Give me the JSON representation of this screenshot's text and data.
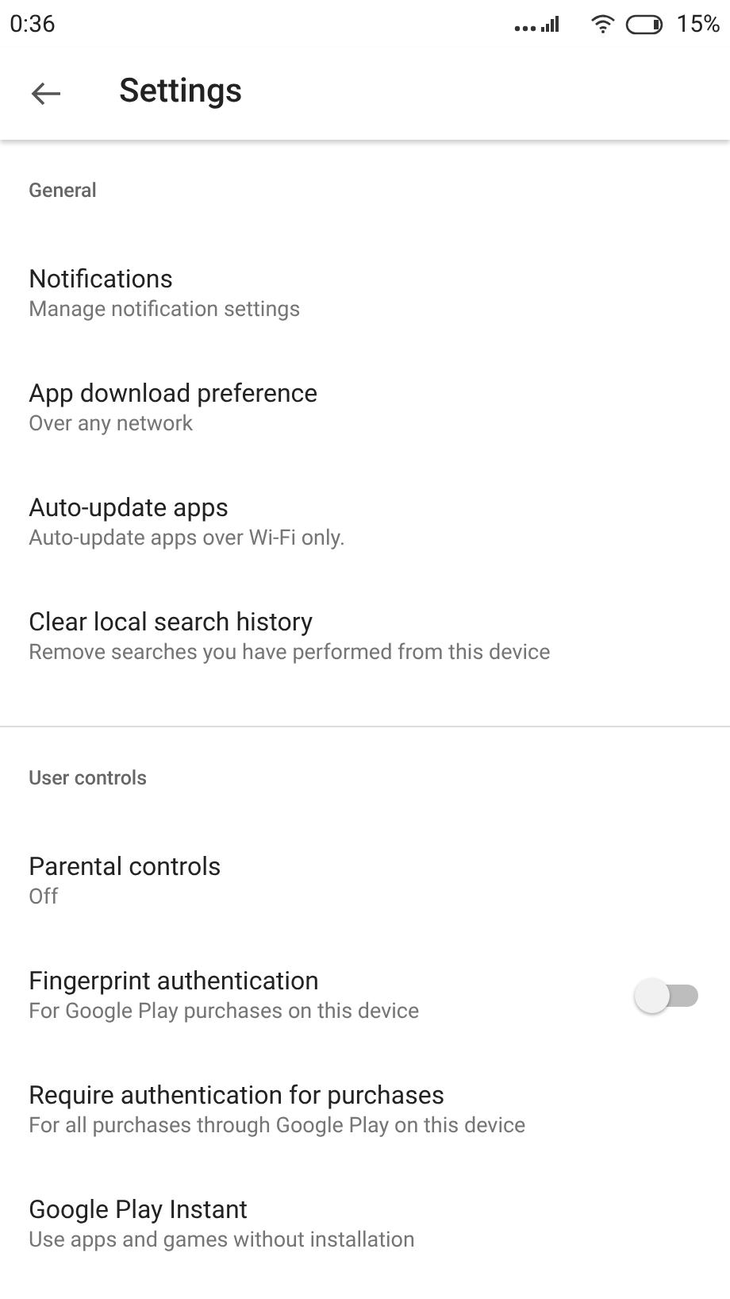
{
  "status_bar": {
    "time": "0:36",
    "battery": "15%"
  },
  "app_bar": {
    "title": "Settings"
  },
  "sections": [
    {
      "title": "General",
      "items": [
        {
          "title": "Notifications",
          "subtitle": "Manage notification settings"
        },
        {
          "title": "App download preference",
          "subtitle": "Over any network"
        },
        {
          "title": "Auto-update apps",
          "subtitle": "Auto-update apps over Wi-Fi only."
        },
        {
          "title": "Clear local search history",
          "subtitle": "Remove searches you have performed from this device"
        }
      ]
    },
    {
      "title": "User controls",
      "items": [
        {
          "title": "Parental controls",
          "subtitle": "Off"
        },
        {
          "title": "Fingerprint authentication",
          "subtitle": "For Google Play purchases on this device",
          "kind": "toggle",
          "on": false
        },
        {
          "title": "Require authentication for purchases",
          "subtitle": "For all purchases through Google Play on this device"
        },
        {
          "title": "Google Play Instant",
          "subtitle": "Use apps and games without installation"
        }
      ]
    }
  ]
}
